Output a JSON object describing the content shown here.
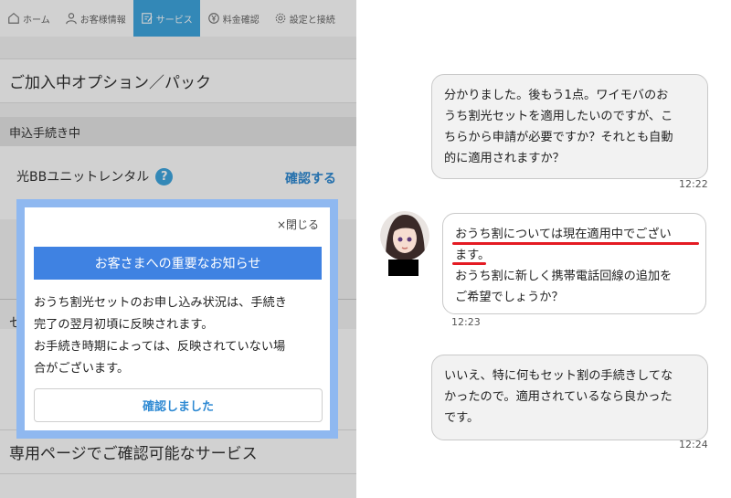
{
  "nav": {
    "items": [
      {
        "label": "ホーム",
        "icon": "home-icon"
      },
      {
        "label": "お客様情報",
        "icon": "user-icon"
      },
      {
        "label": "サービス",
        "icon": "edit-icon",
        "active": true
      },
      {
        "label": "料金確認",
        "icon": "yen-icon"
      },
      {
        "label": "設定と接続",
        "icon": "gear-icon"
      }
    ]
  },
  "page": {
    "section_title": "ご加入中オプション／パック",
    "sub_heading": "申込手続き中",
    "option_name": "光BBユニットレンタル",
    "help_icon_label": "?",
    "confirm_link": "確認する",
    "partial_char": "セ",
    "footer_section_title": "専用ページでご確認可能なサービス"
  },
  "modal": {
    "close_label": "×閉じる",
    "title": "お客さまへの重要なお知らせ",
    "body_lines": [
      "おうち割光セットのお申し込み状況は、手続き",
      "完了の翌月初頃に反映されます。",
      "お手続き時期によっては、反映されていない場",
      "合がございます。"
    ],
    "button_label": "確認しました"
  },
  "chat": {
    "messages": [
      {
        "sender": "user",
        "lines": [
          "分かりました。後もう1点。ワイモバのお",
          "うち割光セットを適用したいのですが、こ",
          "ちらから申請が必要ですか？それとも自動",
          "的に適用されますか？"
        ],
        "time": "12:22"
      },
      {
        "sender": "bot",
        "lines": [
          "おうち割については現在適用中でござい",
          "ます。",
          "おうち割に新しく携帯電話回線の追加を",
          "ご希望でしょうか？"
        ],
        "time": "12:23"
      },
      {
        "sender": "user",
        "lines": [
          "いいえ、特に何もセット割の手続きしてな",
          "かったので。適用されているなら良かった",
          "です。"
        ],
        "time": "12:24"
      }
    ]
  },
  "colors": {
    "accent_blue": "#3fa6e0",
    "modal_title_blue": "#3f82e2",
    "modal_border": "#8fb8f0",
    "underline_red": "#e41b23"
  }
}
